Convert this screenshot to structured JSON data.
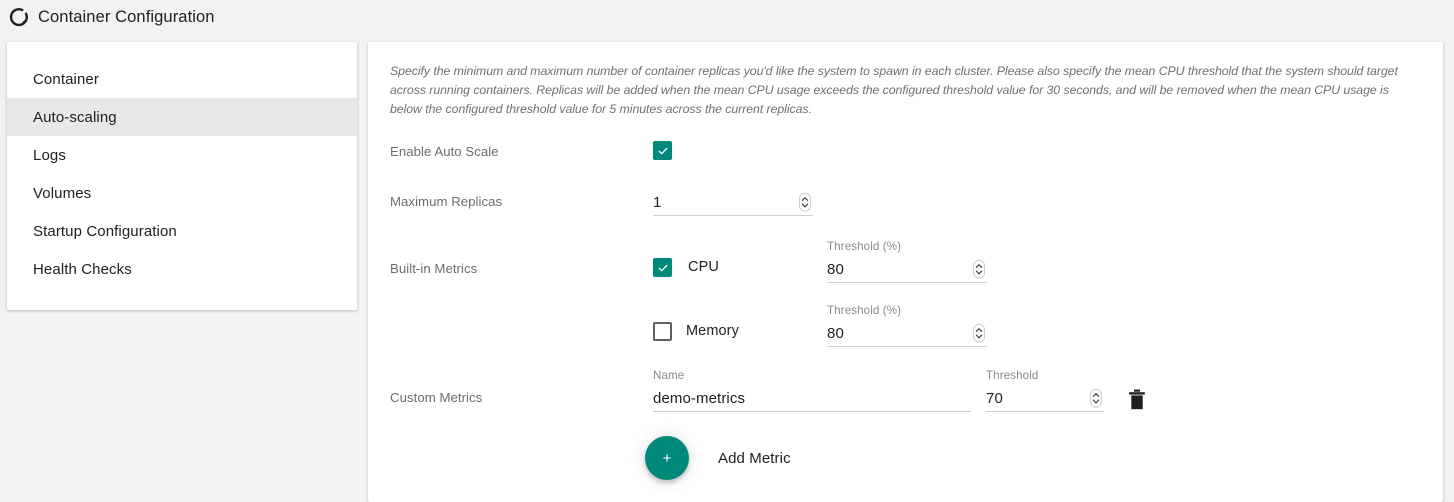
{
  "header": {
    "title": "Container Configuration",
    "logo_icon": "partial-circle-icon"
  },
  "sidebar": {
    "items": [
      {
        "label": "Container",
        "selected": false
      },
      {
        "label": "Auto-scaling",
        "selected": true
      },
      {
        "label": "Logs",
        "selected": false
      },
      {
        "label": "Volumes",
        "selected": false
      },
      {
        "label": "Startup Configuration",
        "selected": false
      },
      {
        "label": "Health Checks",
        "selected": false
      }
    ]
  },
  "main": {
    "description": "Specify the minimum and maximum number of container replicas you'd like the system to spawn in each cluster. Please also specify the mean CPU threshold that the system should target across running containers. Replicas will be added when the mean CPU usage exceeds the configured threshold value for 30 seconds, and will be removed when the mean CPU usage is below the configured threshold value for 5 minutes across the current replicas.",
    "enable_auto_scale": {
      "label": "Enable Auto Scale",
      "checked": true
    },
    "maximum_replicas": {
      "label": "Maximum Replicas",
      "value": "1"
    },
    "builtin_metrics": {
      "label": "Built-in Metrics",
      "rows": [
        {
          "name": "CPU",
          "checked": true,
          "threshold_caption": "Threshold (%)",
          "threshold_value": "80"
        },
        {
          "name": "Memory",
          "checked": false,
          "threshold_caption": "Threshold (%)",
          "threshold_value": "80"
        }
      ]
    },
    "custom_metrics": {
      "label": "Custom Metrics",
      "name_caption": "Name",
      "name_value": "demo-metrics",
      "threshold_caption": "Threshold",
      "threshold_value": "70",
      "delete_icon": "trash-icon"
    },
    "add_metric": {
      "icon": "plus-icon",
      "icon_label": "+",
      "label": "Add Metric"
    }
  },
  "colors": {
    "accent": "#00897b",
    "page_bg": "#f2f2f2",
    "card_bg": "#ffffff",
    "selected_nav_bg": "#e8e8e8",
    "label_text": "#6d6d6d",
    "primary_text": "#212121"
  }
}
